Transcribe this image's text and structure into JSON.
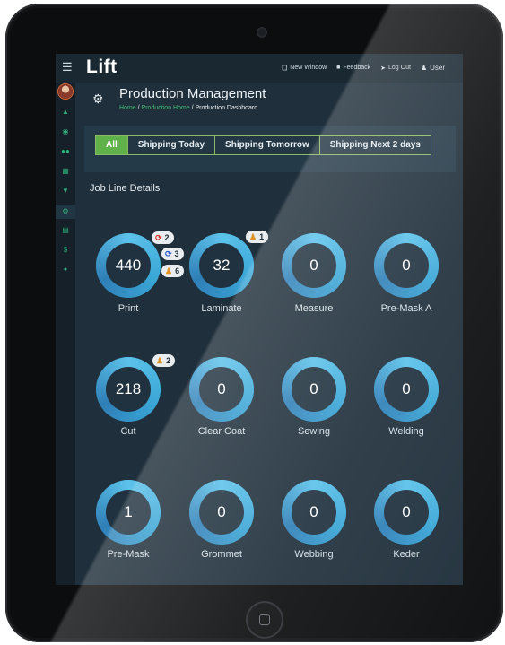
{
  "app": {
    "brand": "Lift",
    "menu_icon": "hamburger-icon"
  },
  "toplinks": {
    "new_window": "New Window",
    "feedback": "Feedback",
    "logout": "Log Out",
    "user": "User"
  },
  "header": {
    "title": "Production Management",
    "breadcrumb": {
      "home": "Home",
      "sep1": "/",
      "prod_home": "Production Home",
      "sep2": "/",
      "current": "Production Dashboard"
    }
  },
  "filters": {
    "tabs": [
      "All",
      "Shipping Today",
      "Shipping Tomorrow",
      "Shipping Next 2 days"
    ],
    "active": "All"
  },
  "section": {
    "title": "Job Line Details"
  },
  "sidebar_icons": [
    "home-icon",
    "dashboard-icon",
    "users-icon",
    "table-icon",
    "cart-icon",
    "cogs-icon",
    "document-icon",
    "dollar-icon",
    "wrench-icon"
  ],
  "gauges": [
    {
      "label": "Print",
      "value": "440"
    },
    {
      "label": "Laminate",
      "value": "32"
    },
    {
      "label": "Measure",
      "value": "0"
    },
    {
      "label": "Pre-Mask A",
      "value": "0"
    },
    {
      "label": "Cut",
      "value": "218"
    },
    {
      "label": "Clear Coat",
      "value": "0"
    },
    {
      "label": "Sewing",
      "value": "0"
    },
    {
      "label": "Welding",
      "value": "0"
    },
    {
      "label": "Pre-Mask",
      "value": "1"
    },
    {
      "label": "Grommet",
      "value": "0"
    },
    {
      "label": "Webbing",
      "value": "0"
    },
    {
      "label": "Keder",
      "value": "0"
    }
  ],
  "badges": {
    "print_red": "2",
    "print_blue": "3",
    "print_orange": "6",
    "laminate_orange": "1",
    "cut_orange": "2"
  },
  "colors": {
    "accent_green": "#5fb24a",
    "gauge_blue": "#3aa6d6",
    "sidebar_green": "#2fb07b"
  }
}
